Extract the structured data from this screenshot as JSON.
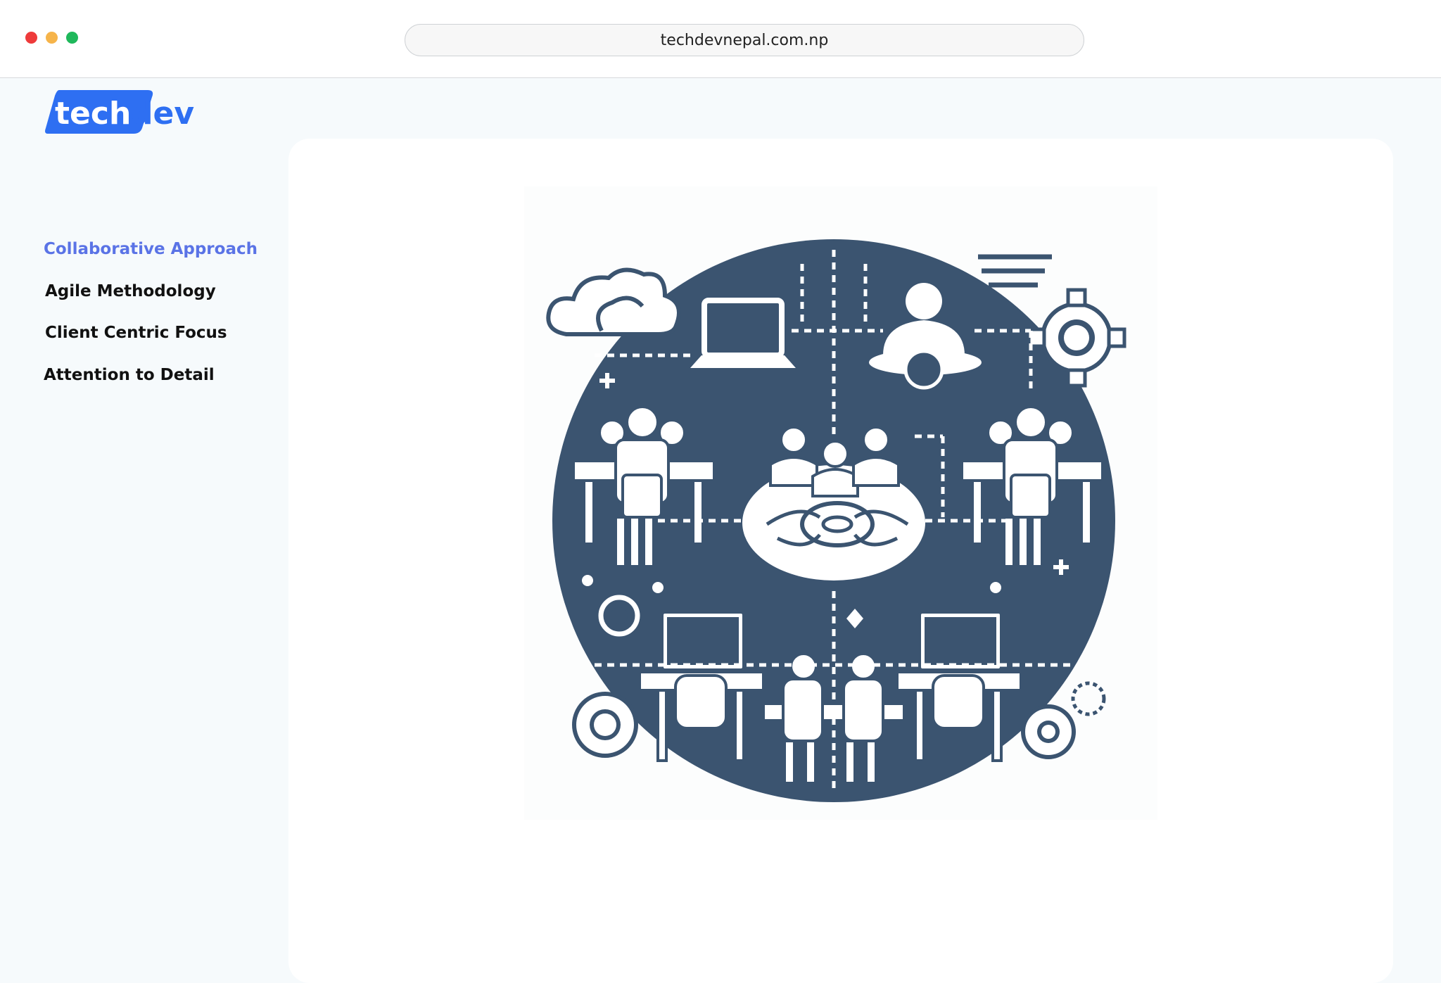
{
  "browser": {
    "url": "techdevnepal.com.np",
    "window_controls": [
      "close",
      "minimize",
      "maximize"
    ]
  },
  "brand": {
    "logo_text_left": "tech",
    "logo_text_right": "dev",
    "logo_color": "#2e6ff2"
  },
  "sidebar": {
    "items": [
      {
        "label": "Collaborative Approach",
        "active": true
      },
      {
        "label": "Agile Methodology",
        "active": false
      },
      {
        "label": "Client Centric Focus",
        "active": false
      },
      {
        "label": "Attention to Detail",
        "active": false
      }
    ]
  },
  "main": {
    "illustration": "collaboration-team-network-illustration",
    "illustration_color": "#3b5470"
  },
  "colors": {
    "accent": "#5a73e6",
    "background": "#f6fafc",
    "card": "#ffffff"
  }
}
